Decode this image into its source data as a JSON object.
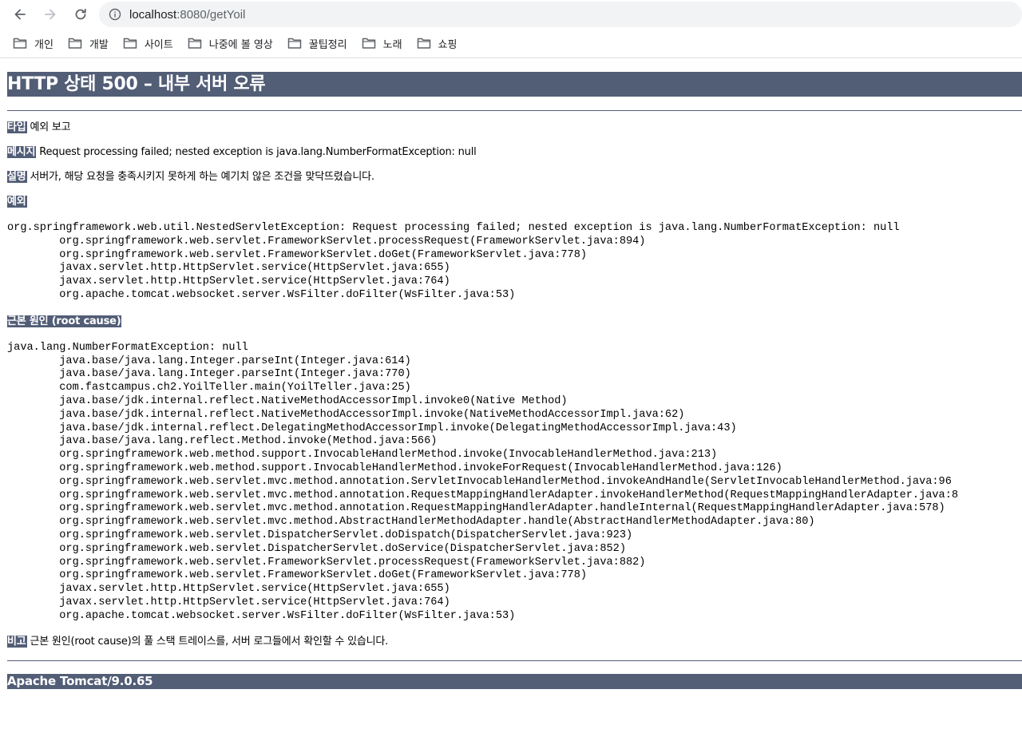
{
  "browser": {
    "url_host": "localhost",
    "url_rest": ":8080/getYoil",
    "bookmarks": [
      "개인",
      "개발",
      "사이트",
      "나중에 볼 영상",
      "꿀팁정리",
      "노래",
      "쇼핑"
    ]
  },
  "page": {
    "title": "HTTP 상태 500 – 내부 서버 오류",
    "type_label": "타입",
    "type_value": "예외 보고",
    "message_label": "메시지",
    "message_value": "Request processing failed; nested exception is java.lang.NumberFormatException: null",
    "description_label": "설명",
    "description_value": "서버가, 해당 요청을 충족시키지 못하게 하는 예기치 않은 조건을 맞닥뜨렸습니다.",
    "exception_label": "예외",
    "exception_trace": "org.springframework.web.util.NestedServletException: Request processing failed; nested exception is java.lang.NumberFormatException: null\n\torg.springframework.web.servlet.FrameworkServlet.processRequest(FrameworkServlet.java:894)\n\torg.springframework.web.servlet.FrameworkServlet.doGet(FrameworkServlet.java:778)\n\tjavax.servlet.http.HttpServlet.service(HttpServlet.java:655)\n\tjavax.servlet.http.HttpServlet.service(HttpServlet.java:764)\n\torg.apache.tomcat.websocket.server.WsFilter.doFilter(WsFilter.java:53)",
    "root_cause_label": "근본 원인 (root cause)",
    "root_cause_trace": "java.lang.NumberFormatException: null\n\tjava.base/java.lang.Integer.parseInt(Integer.java:614)\n\tjava.base/java.lang.Integer.parseInt(Integer.java:770)\n\tcom.fastcampus.ch2.YoilTeller.main(YoilTeller.java:25)\n\tjava.base/jdk.internal.reflect.NativeMethodAccessorImpl.invoke0(Native Method)\n\tjava.base/jdk.internal.reflect.NativeMethodAccessorImpl.invoke(NativeMethodAccessorImpl.java:62)\n\tjava.base/jdk.internal.reflect.DelegatingMethodAccessorImpl.invoke(DelegatingMethodAccessorImpl.java:43)\n\tjava.base/java.lang.reflect.Method.invoke(Method.java:566)\n\torg.springframework.web.method.support.InvocableHandlerMethod.invoke(InvocableHandlerMethod.java:213)\n\torg.springframework.web.method.support.InvocableHandlerMethod.invokeForRequest(InvocableHandlerMethod.java:126)\n\torg.springframework.web.servlet.mvc.method.annotation.ServletInvocableHandlerMethod.invokeAndHandle(ServletInvocableHandlerMethod.java:96\n\torg.springframework.web.servlet.mvc.method.annotation.RequestMappingHandlerAdapter.invokeHandlerMethod(RequestMappingHandlerAdapter.java:8\n\torg.springframework.web.servlet.mvc.method.annotation.RequestMappingHandlerAdapter.handleInternal(RequestMappingHandlerAdapter.java:578)\n\torg.springframework.web.servlet.mvc.method.AbstractHandlerMethodAdapter.handle(AbstractHandlerMethodAdapter.java:80)\n\torg.springframework.web.servlet.DispatcherServlet.doDispatch(DispatcherServlet.java:923)\n\torg.springframework.web.servlet.DispatcherServlet.doService(DispatcherServlet.java:852)\n\torg.springframework.web.servlet.FrameworkServlet.processRequest(FrameworkServlet.java:882)\n\torg.springframework.web.servlet.FrameworkServlet.doGet(FrameworkServlet.java:778)\n\tjavax.servlet.http.HttpServlet.service(HttpServlet.java:655)\n\tjavax.servlet.http.HttpServlet.service(HttpServlet.java:764)\n\torg.apache.tomcat.websocket.server.WsFilter.doFilter(WsFilter.java:53)",
    "note_label": "비고",
    "note_value": "근본 원인(root cause)의 풀 스택 트레이스를, 서버 로그들에서 확인할 수 있습니다.",
    "footer": "Apache Tomcat/9.0.65"
  },
  "colors": {
    "tomcat_header_bg": "#525d76",
    "omnibox_bg": "#f1f3f4"
  },
  "icons": [
    "back-arrow-icon",
    "forward-arrow-icon",
    "reload-icon",
    "info-icon",
    "folder-icon"
  ]
}
